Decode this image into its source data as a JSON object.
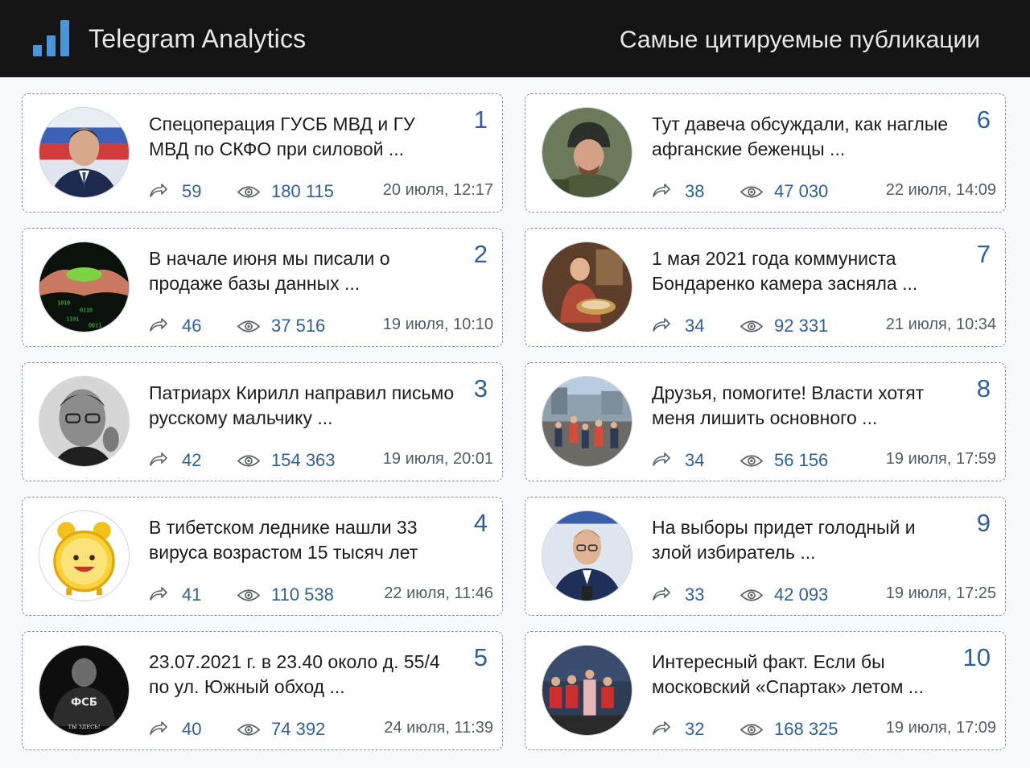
{
  "header": {
    "brand": "Telegram Analytics",
    "title": "Самые цитируемые публикации"
  },
  "colors": {
    "header_bg": "#141414",
    "accent": "#2f5f9e",
    "logo": "#4a95d9"
  },
  "icons": {
    "share": "share-arrow-icon",
    "views": "eye-icon",
    "logo": "bar-chart-icon"
  },
  "posts": [
    {
      "rank": "1",
      "text": "Спецоперация ГУСБ МВД и ГУ МВД по СКФО при силовой ...",
      "shares": "59",
      "views": "180 115",
      "date": "20 июля, 12:17",
      "avatar": "man-in-suit-flag-photo"
    },
    {
      "rank": "2",
      "text": "В начале июня мы писали о продаже базы данных ...",
      "shares": "46",
      "views": "37 516",
      "date": "19 июля, 10:10",
      "avatar": "hands-with-data-photo"
    },
    {
      "rank": "3",
      "text": "Патриарх Кирилл направил письмо русскому мальчику ...",
      "shares": "42",
      "views": "154 363",
      "date": "19 июля, 20:01",
      "avatar": "bw-man-glasses-photo"
    },
    {
      "rank": "4",
      "text": "В тибетском леднике нашли 33 вируса возрастом 15 тысяч лет",
      "shares": "41",
      "views": "110 538",
      "date": "22 июля, 11:46",
      "avatar": "yellow-alarm-clock-photo"
    },
    {
      "rank": "5",
      "text": "23.07.2021 г. в 23.40 около д. 55/4 по ул. Южный обход ...",
      "shares": "40",
      "views": "74 392",
      "date": "24 июля, 11:39",
      "avatar": "fsb-officer-photo",
      "avatar_caption": "ФСБ"
    },
    {
      "rank": "6",
      "text": "Тут давеча обсуждали, как наглые афганские беженцы ...",
      "shares": "38",
      "views": "47 030",
      "date": "22 июля, 14:09",
      "avatar": "soldier-helmet-photo"
    },
    {
      "rank": "7",
      "text": "1 мая 2021 года коммуниста Бондаренко камера засняла ...",
      "shares": "34",
      "views": "92 331",
      "date": "21 июля, 10:34",
      "avatar": "painting-woman-photo"
    },
    {
      "rank": "8",
      "text": "Друзья, помогите! Власти хотят меня лишить основного ...",
      "shares": "34",
      "views": "56 156",
      "date": "19 июля, 17:59",
      "avatar": "crowd-street-photo"
    },
    {
      "rank": "9",
      "text": "На выборы придет голодный и злой избиратель ...",
      "shares": "33",
      "views": "42 093",
      "date": "19 июля, 17:25",
      "avatar": "man-glasses-microphone-photo"
    },
    {
      "rank": "10",
      "text": "Интересный факт. Если бы московский «Спартак» летом ...",
      "shares": "32",
      "views": "168 325",
      "date": "19 июля, 17:09",
      "avatar": "football-team-photo"
    }
  ]
}
